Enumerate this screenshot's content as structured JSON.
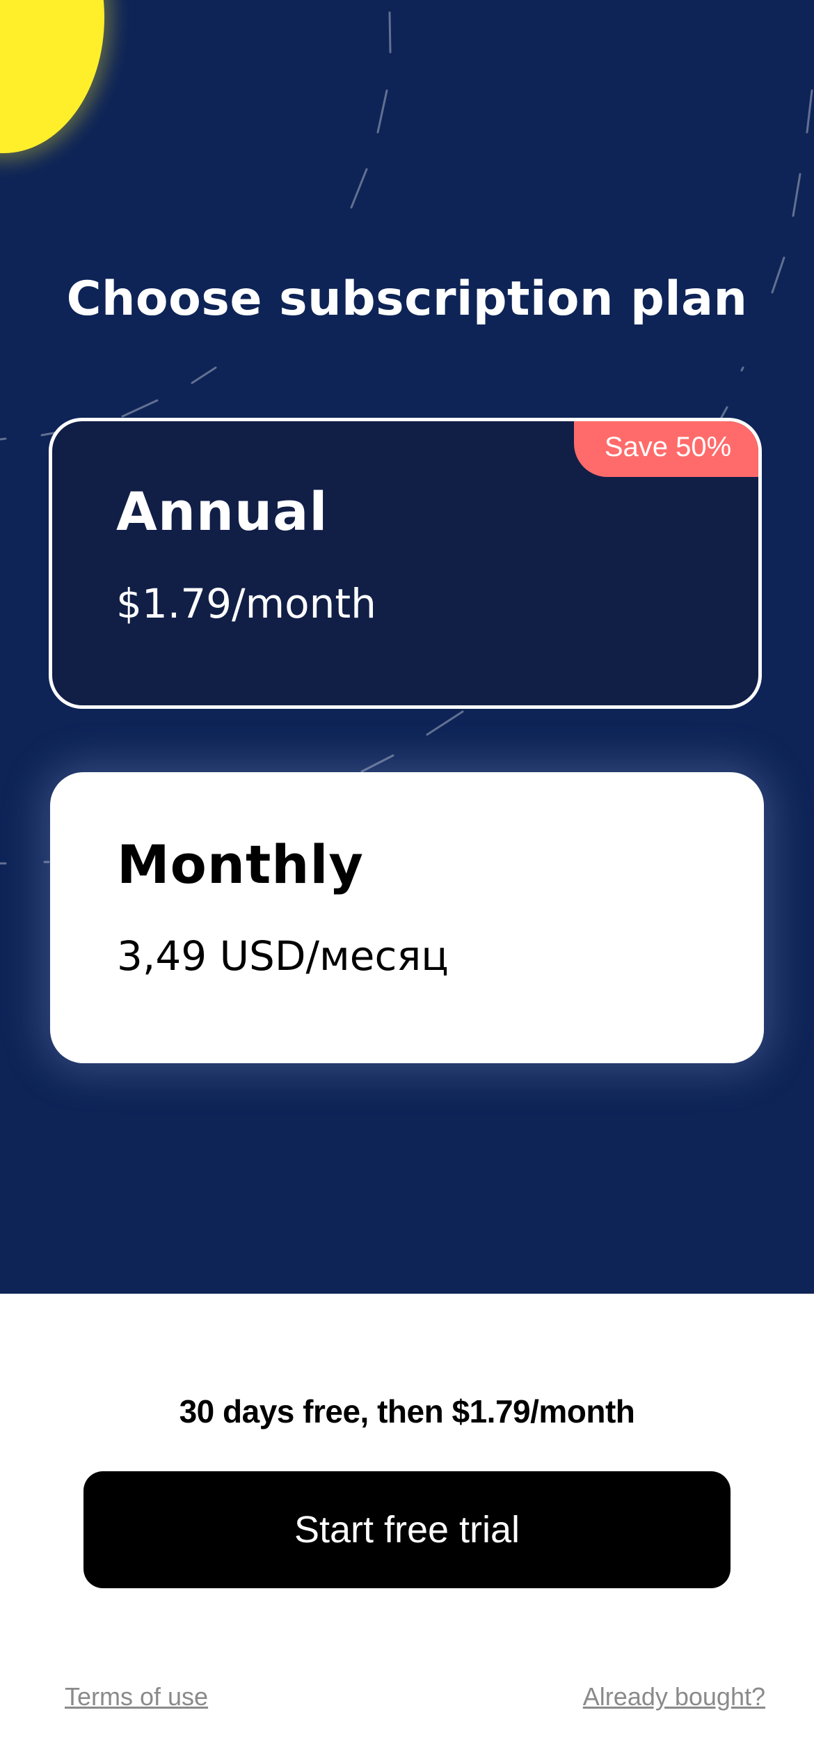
{
  "header": {
    "title": "Choose subscription plan"
  },
  "plans": [
    {
      "name": "Annual",
      "price": "$1.79/month",
      "badge": "Save 50%",
      "selected": true
    },
    {
      "name": "Monthly",
      "price": "3,49 USD/месяц",
      "selected": false
    }
  ],
  "footer": {
    "trial_note": "30 days free, then $1.79/month",
    "cta_label": "Start free trial",
    "terms_label": "Terms of use",
    "restore_label": "Already bought?"
  },
  "colors": {
    "background": "#0e2457",
    "selected_card": "#111f47",
    "badge": "#ff6b6b",
    "sun": "#ffef2a",
    "cta": "#000000"
  },
  "icons": {
    "decoration": "sun-icon"
  }
}
